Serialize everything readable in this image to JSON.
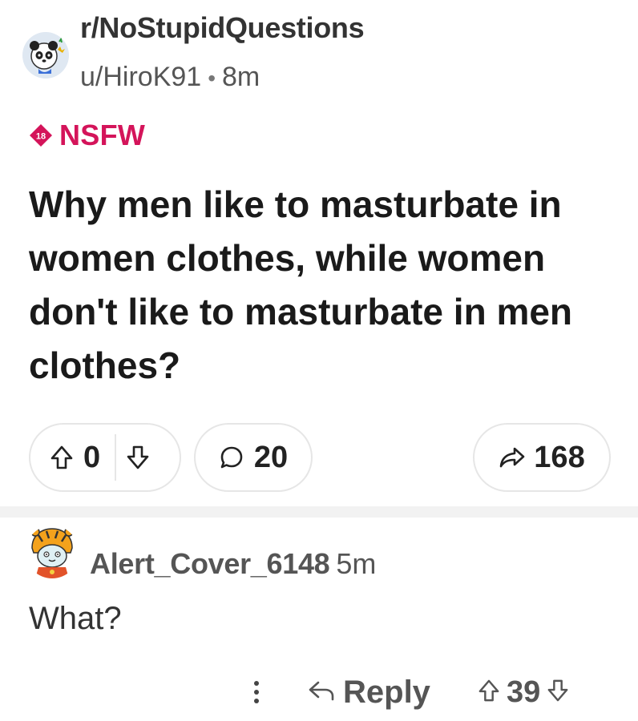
{
  "post": {
    "subreddit": "r/NoStupidQuestions",
    "author": "u/HiroK91",
    "separator": "•",
    "age": "8m",
    "nsfw_badge": "18",
    "nsfw_label": "NSFW",
    "title": "Why men like to masturbate in women clothes, while women don't like to masturbate in men clothes?",
    "score": "0",
    "comment_count": "20",
    "share_count": "168"
  },
  "comment": {
    "author": "Alert_Cover_6148",
    "age": "5m",
    "body": "What?",
    "reply_label": "Reply",
    "score": "39"
  },
  "icons": {
    "sub_avatar": "panda-avatar-icon",
    "user_avatar": "tiger-avatar-icon",
    "nsfw": "nsfw-18-icon",
    "upvote": "upvote-arrow-icon",
    "downvote": "downvote-arrow-icon",
    "comment": "comment-bubble-icon",
    "share": "share-arrow-icon",
    "more": "more-vertical-icon",
    "reply": "reply-arrow-icon"
  },
  "colors": {
    "nsfw": "#d4145a",
    "text": "#1a1a1a",
    "muted": "#555555",
    "border": "#e6e6e6"
  }
}
